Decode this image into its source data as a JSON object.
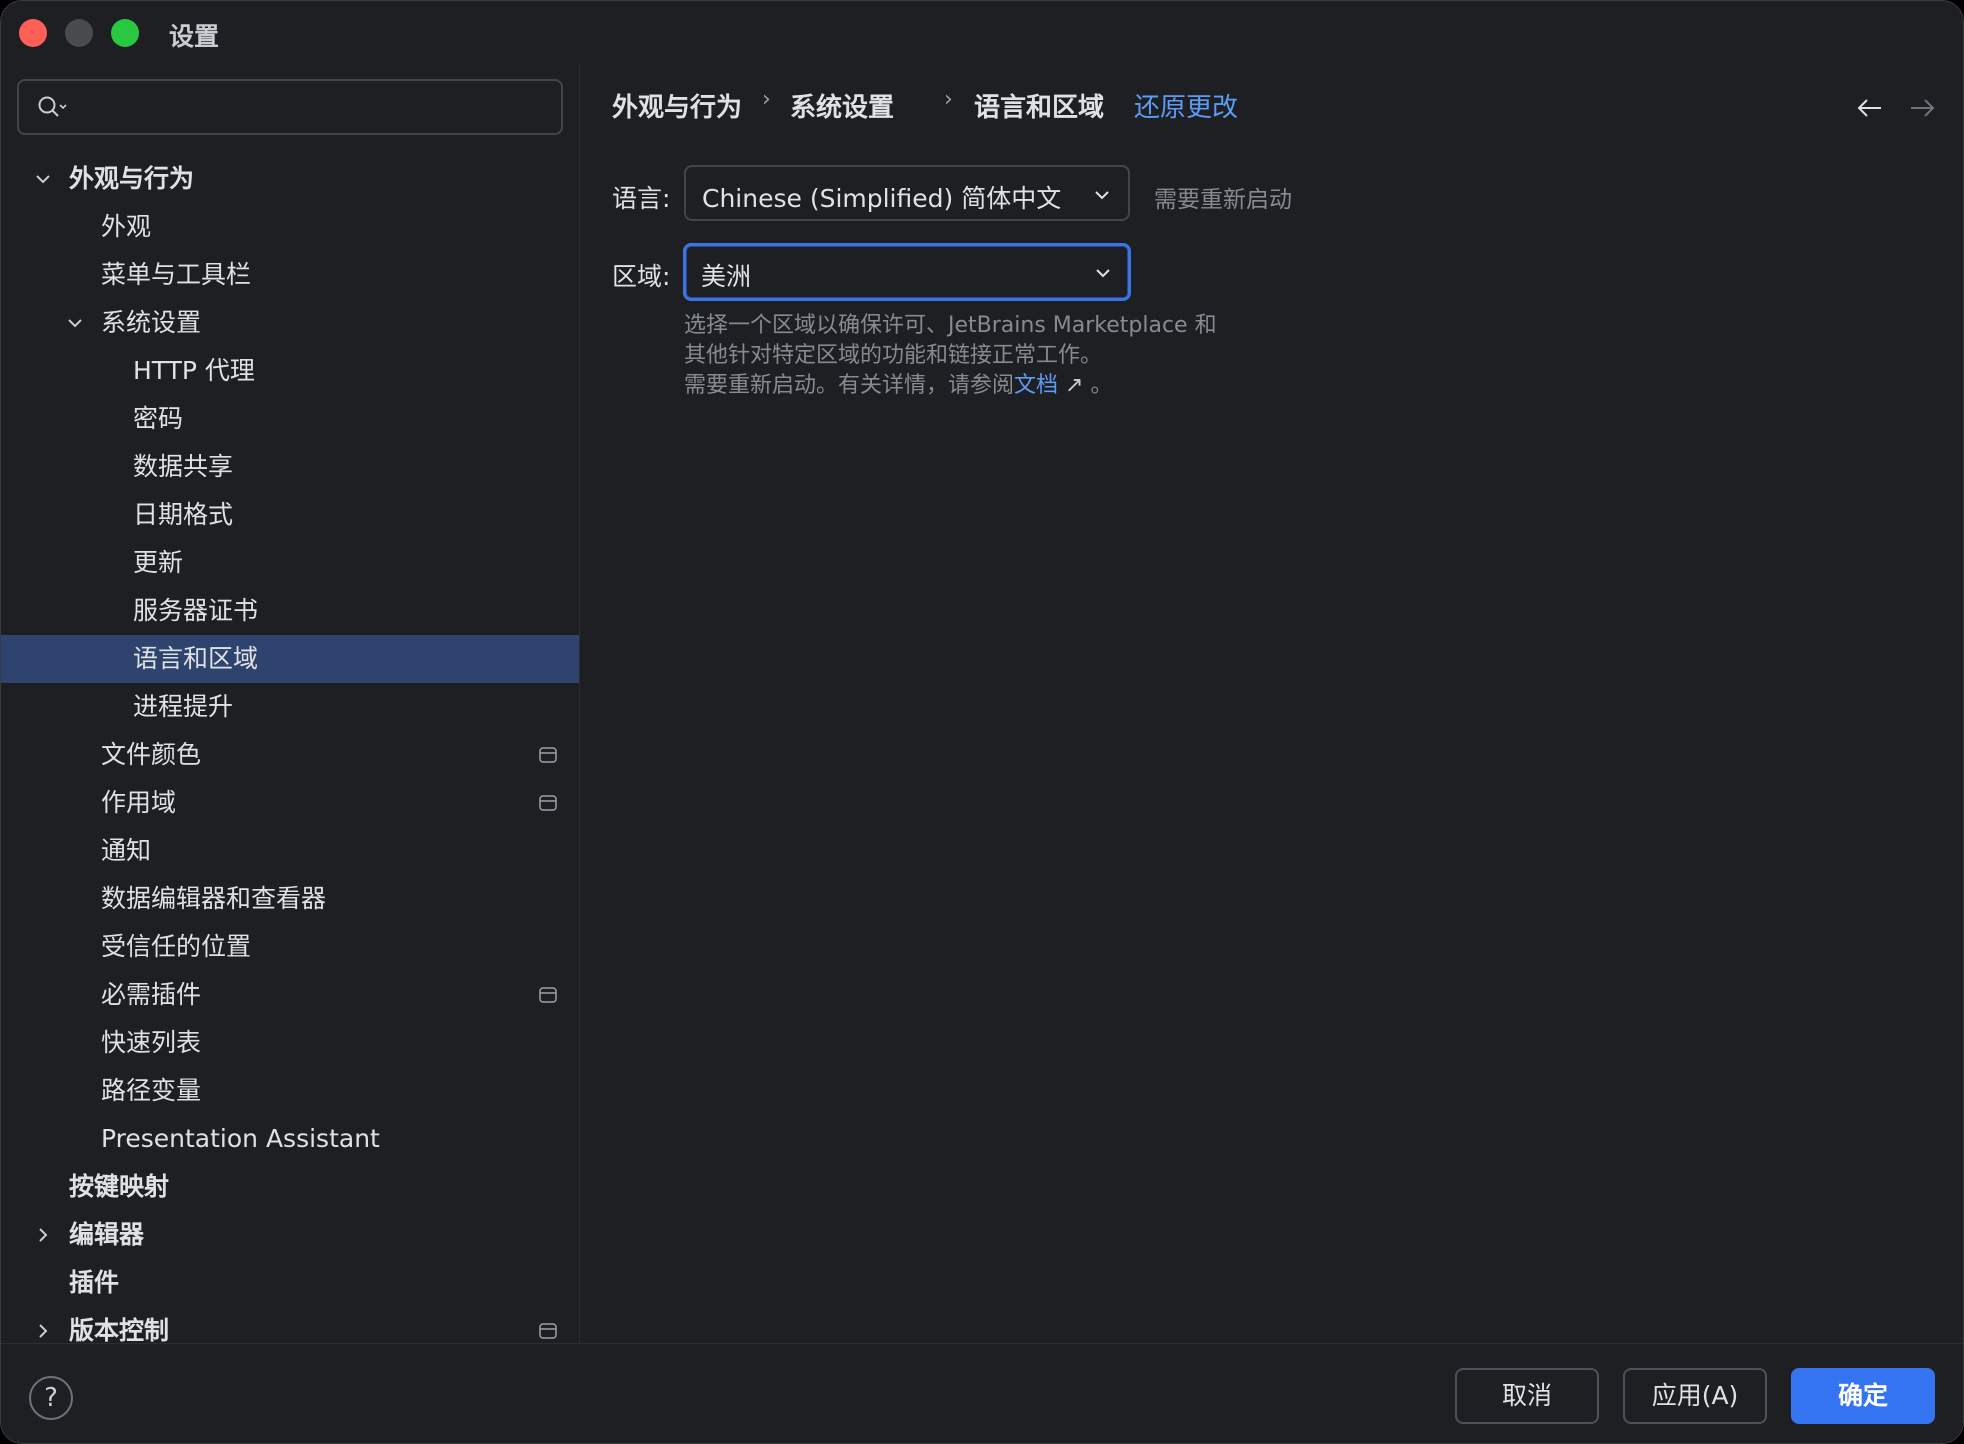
{
  "window": {
    "title": "设置"
  },
  "search": {
    "value": "",
    "placeholder": ""
  },
  "sidebar": {
    "items": [
      {
        "label": "外观与行为",
        "level": 0,
        "expanded": true,
        "bold": true
      },
      {
        "label": "外观",
        "level": 1
      },
      {
        "label": "菜单与工具栏",
        "level": 1
      },
      {
        "label": "系统设置",
        "level": 1,
        "expanded": true
      },
      {
        "label": "HTTP 代理",
        "level": 2
      },
      {
        "label": "密码",
        "level": 2
      },
      {
        "label": "数据共享",
        "level": 2
      },
      {
        "label": "日期格式",
        "level": 2
      },
      {
        "label": "更新",
        "level": 2
      },
      {
        "label": "服务器证书",
        "level": 2
      },
      {
        "label": "语言和区域",
        "level": 2,
        "selected": true
      },
      {
        "label": "进程提升",
        "level": 2
      },
      {
        "label": "文件颜色",
        "level": 1,
        "badge": true
      },
      {
        "label": "作用域",
        "level": 1,
        "badge": true
      },
      {
        "label": "通知",
        "level": 1
      },
      {
        "label": "数据编辑器和查看器",
        "level": 1
      },
      {
        "label": "受信任的位置",
        "level": 1
      },
      {
        "label": "必需插件",
        "level": 1,
        "badge": true
      },
      {
        "label": "快速列表",
        "level": 1
      },
      {
        "label": "路径变量",
        "level": 1
      },
      {
        "label": "Presentation Assistant",
        "level": 1
      },
      {
        "label": "按键映射",
        "level": 0,
        "bold": true
      },
      {
        "label": "编辑器",
        "level": 0,
        "collapsed": true,
        "bold": true
      },
      {
        "label": "插件",
        "level": 0,
        "bold": true
      },
      {
        "label": "版本控制",
        "level": 0,
        "collapsed": true,
        "bold": true,
        "badge": true
      }
    ]
  },
  "breadcrumb": {
    "items": [
      "外观与行为",
      "系统设置",
      "语言和区域"
    ],
    "separator": "›",
    "revert": "还原更改"
  },
  "form": {
    "language_label": "语言:",
    "language_value": "Chinese (Simplified) 简体中文",
    "language_hint": "需要重新启动",
    "region_label": "区域:",
    "region_value": "美洲",
    "desc_line1": "选择一个区域以确保许可、JetBrains Marketplace 和",
    "desc_line2": "其他针对特定区域的功能和链接正常工作。",
    "desc_line3_prefix": "需要重新启动。有关详情，请参阅",
    "desc_link": "文档",
    "desc_link_arrow": "↗",
    "desc_line3_suffix": " 。"
  },
  "footer": {
    "help": "?",
    "cancel": "取消",
    "apply": "应用(A)",
    "ok": "确定"
  },
  "colors": {
    "background": "#1e1f22",
    "selection": "#2e436e",
    "accent": "#3574f0",
    "link": "#5e9bf5"
  }
}
